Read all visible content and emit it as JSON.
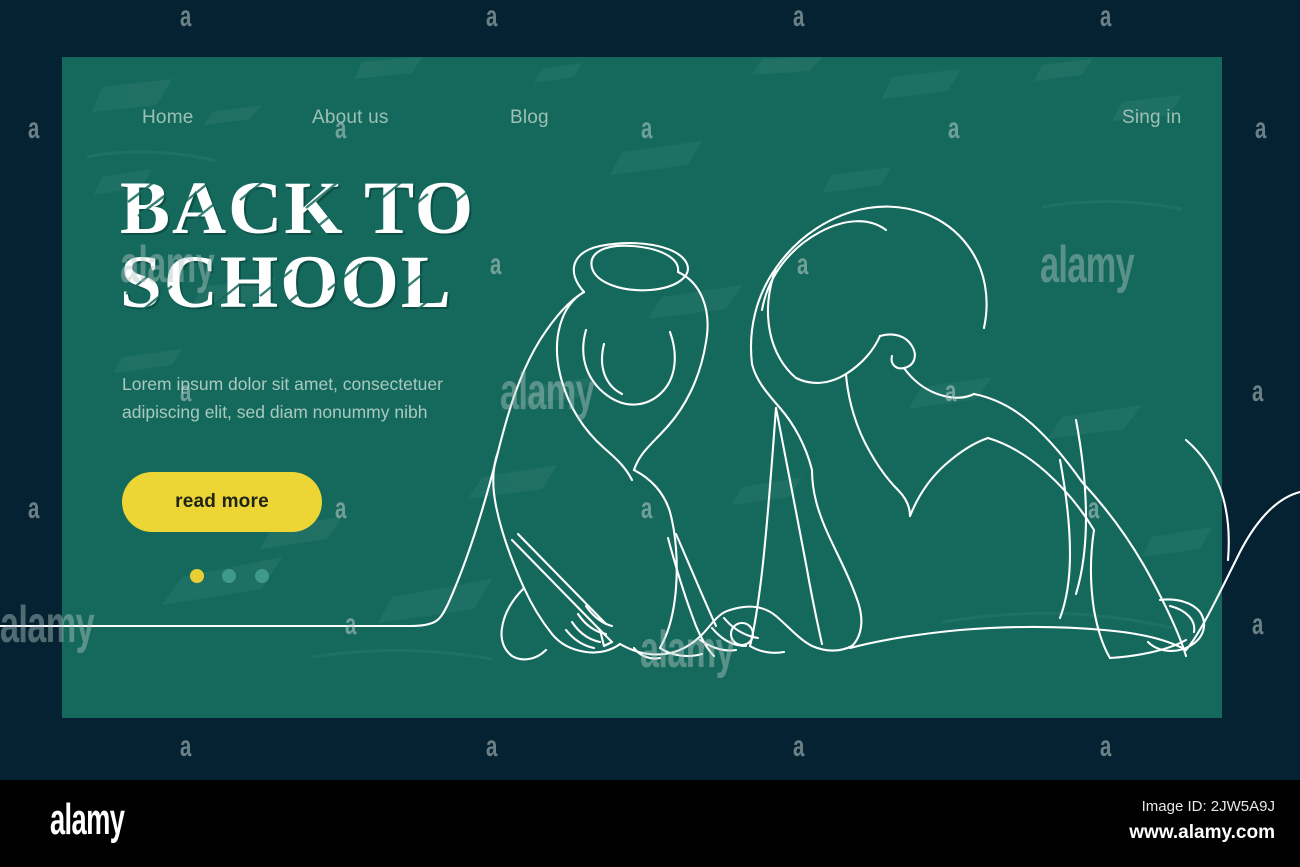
{
  "page": {
    "background_color": "#052233",
    "board_color": "#14695c",
    "accent_yellow": "#ecd534",
    "line_color": "#ffffff",
    "muted_text_color": "#a9c9c0"
  },
  "nav": {
    "items": [
      {
        "label": "Home"
      },
      {
        "label": "About us"
      },
      {
        "label": "Blog"
      }
    ],
    "signin_label": "Sing in"
  },
  "hero": {
    "title_line1": "BACK TO",
    "title_line2": "SCHOOL",
    "subtitle_line1": "Lorem ipsum dolor sit amet, consectetuer",
    "subtitle_line2": "adipiscing elit, sed diam nonummy nibh",
    "cta_label": "read more",
    "carousel": {
      "dots": [
        {
          "state": "active",
          "color": "#e9cf33"
        },
        {
          "state": "idle",
          "color": "#3f998c"
        },
        {
          "state": "idle",
          "color": "#3f998c"
        }
      ]
    }
  },
  "illustration": {
    "name": "one-line-drawing-child-and-adult-writing",
    "style": "continuous single line",
    "stroke_color": "#ffffff"
  },
  "watermark": {
    "logo": "alamy",
    "image_id": "Image ID: 2JW5A9J",
    "url": "www.alamy.com",
    "tile_glyph": "a"
  }
}
